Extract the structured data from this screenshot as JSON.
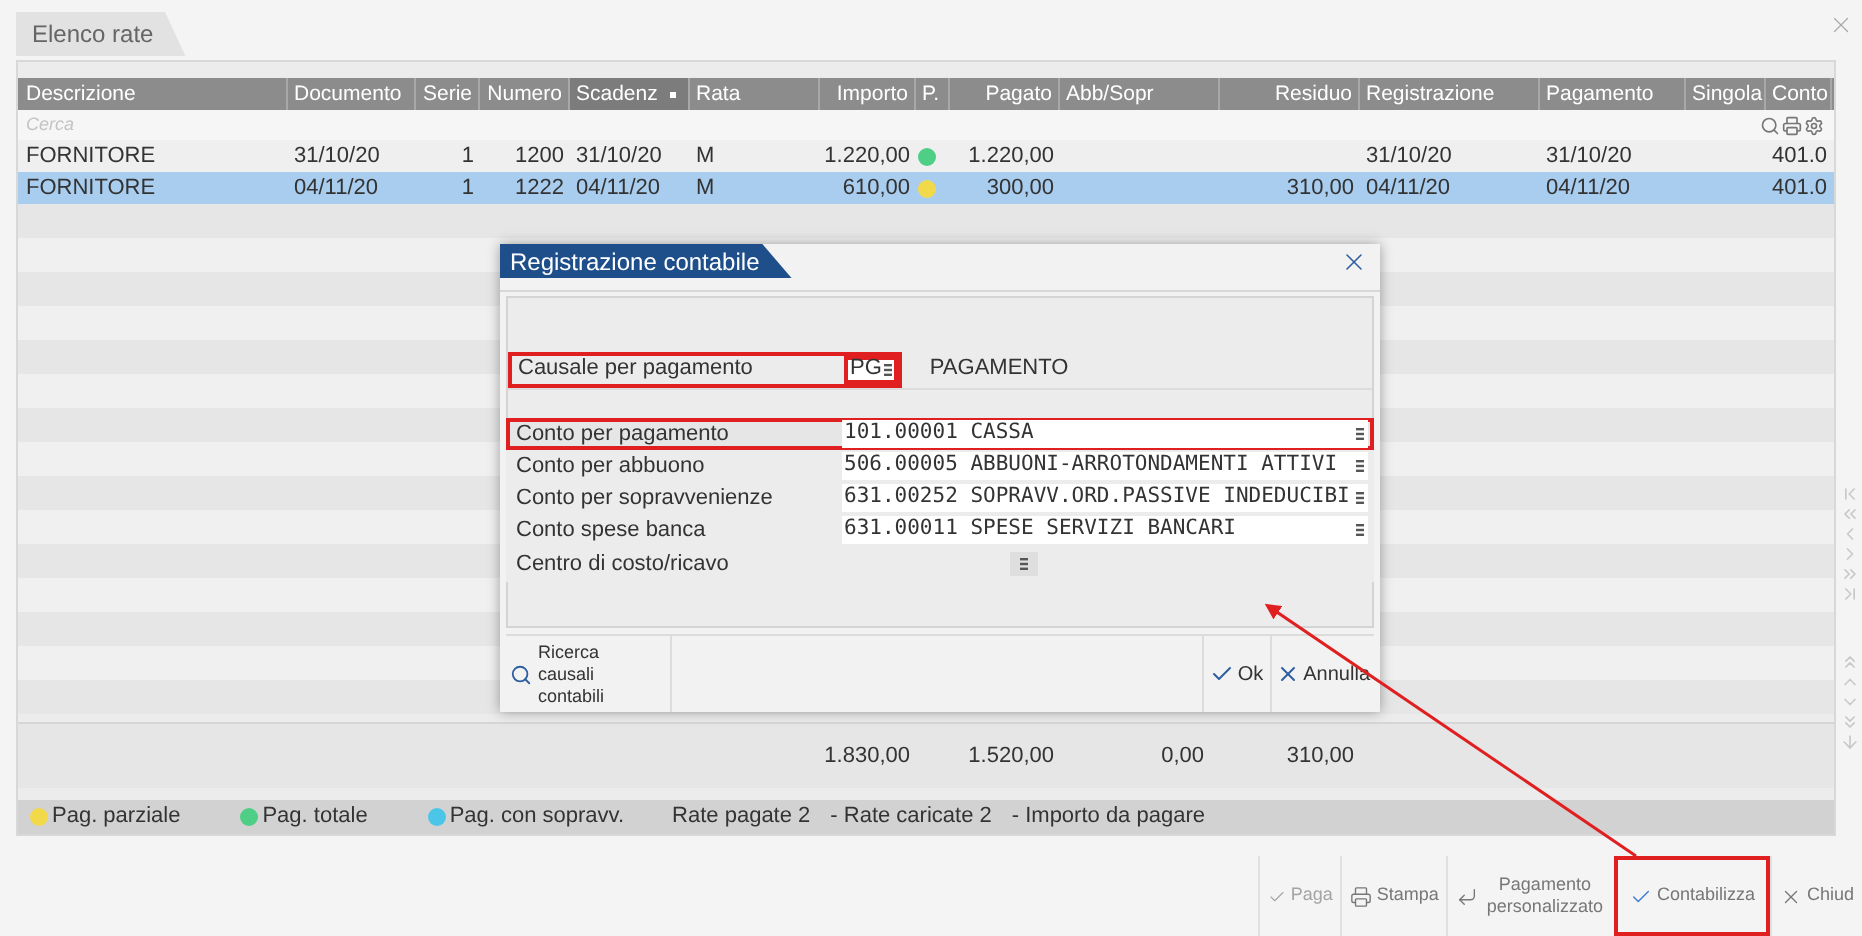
{
  "tab": {
    "label": "Elenco rate"
  },
  "table": {
    "columns": [
      {
        "label": "Descrizione",
        "sorted": false
      },
      {
        "label": "Documento",
        "sorted": false
      },
      {
        "label": "Serie",
        "sorted": false
      },
      {
        "label": "Numero",
        "sorted": false
      },
      {
        "label": "Scadenz",
        "sorted": true
      },
      {
        "label": "Rata",
        "sorted": false
      },
      {
        "label": "Importo",
        "sorted": false
      },
      {
        "label": "P.",
        "sorted": false
      },
      {
        "label": "Pagato",
        "sorted": false
      },
      {
        "label": "Abb/Sopr",
        "sorted": false
      },
      {
        "label": "Residuo",
        "sorted": false
      },
      {
        "label": "Registrazione",
        "sorted": false
      },
      {
        "label": "Pagamento",
        "sorted": false
      },
      {
        "label": "Singola",
        "sorted": false
      },
      {
        "label": "Conto",
        "sorted": false
      }
    ],
    "search_placeholder": "Cerca",
    "rows": [
      {
        "selected": false,
        "color": "#4fcf85",
        "cells": [
          "FORNITORE",
          "31/10/20",
          "1",
          "1200",
          "31/10/20",
          "M",
          "1.220,00",
          null,
          "1.220,00",
          null,
          null,
          "31/10/20",
          "31/10/20",
          null,
          "401.0"
        ]
      },
      {
        "selected": true,
        "color": "#f2d94a",
        "cells": [
          "FORNITORE",
          "04/11/20",
          "1",
          "1222",
          "04/11/20",
          "M",
          "610,00",
          null,
          "300,00",
          null,
          "310,00",
          "04/11/20",
          "04/11/20",
          null,
          "401.0"
        ]
      }
    ],
    "totals": {
      "importo": "1.830,00",
      "pagato": "1.520,00",
      "abb_sopr": "0,00",
      "residuo": "310,00"
    }
  },
  "legend": [
    {
      "label": "Pag. parziale",
      "color": "#f2d94a"
    },
    {
      "label": "Pag. totale",
      "color": "#4fcf85"
    },
    {
      "label": "Pag. con sopravv.",
      "color": "#4cc6e8"
    }
  ],
  "summary": [
    "Rate pagate 2",
    "- Rate caricate 2",
    "- Importo da pagare"
  ],
  "toolbar": [
    {
      "label": "Paga",
      "kind": "pay",
      "disabled": true,
      "highlighted": false
    },
    {
      "label": "Stampa",
      "kind": "print",
      "disabled": false,
      "highlighted": false
    },
    {
      "label": "Pagamento personalizzato",
      "kind": "custom",
      "disabled": false,
      "highlighted": false
    },
    {
      "label": "Contabilizza",
      "kind": "post",
      "disabled": false,
      "highlighted": true
    },
    {
      "label": "Chiud",
      "kind": "close",
      "disabled": false,
      "highlighted": false
    }
  ],
  "dialog": {
    "title": "Registrazione contabile",
    "fields": [
      {
        "kind": "code",
        "label": "Causale per pagamento",
        "value": "PG",
        "description": "PAGAMENTO",
        "highlighted": true
      },
      {
        "kind": "account",
        "label": "Conto per pagamento",
        "value": "101.00001 CASSA",
        "highlighted": true
      },
      {
        "kind": "account",
        "label": "Conto per abbuono",
        "value": "506.00005 ABBUONI-ARROTONDAMENTI ATTIVI",
        "highlighted": false
      },
      {
        "kind": "account",
        "label": "Conto per sopravvenienze",
        "value": "631.00252 SOPRAVV.ORD.PASSIVE INDEDUCIBI",
        "highlighted": false
      },
      {
        "kind": "account",
        "label": "Conto spese banca",
        "value": "631.00011 SPESE SERVIZI BANCARI",
        "highlighted": false
      },
      {
        "kind": "disabled",
        "label": "Centro di costo/ricavo",
        "highlighted": false
      }
    ],
    "search_button": "Ricerca causali contabili",
    "ok": "Ok",
    "cancel": "Annulla"
  }
}
